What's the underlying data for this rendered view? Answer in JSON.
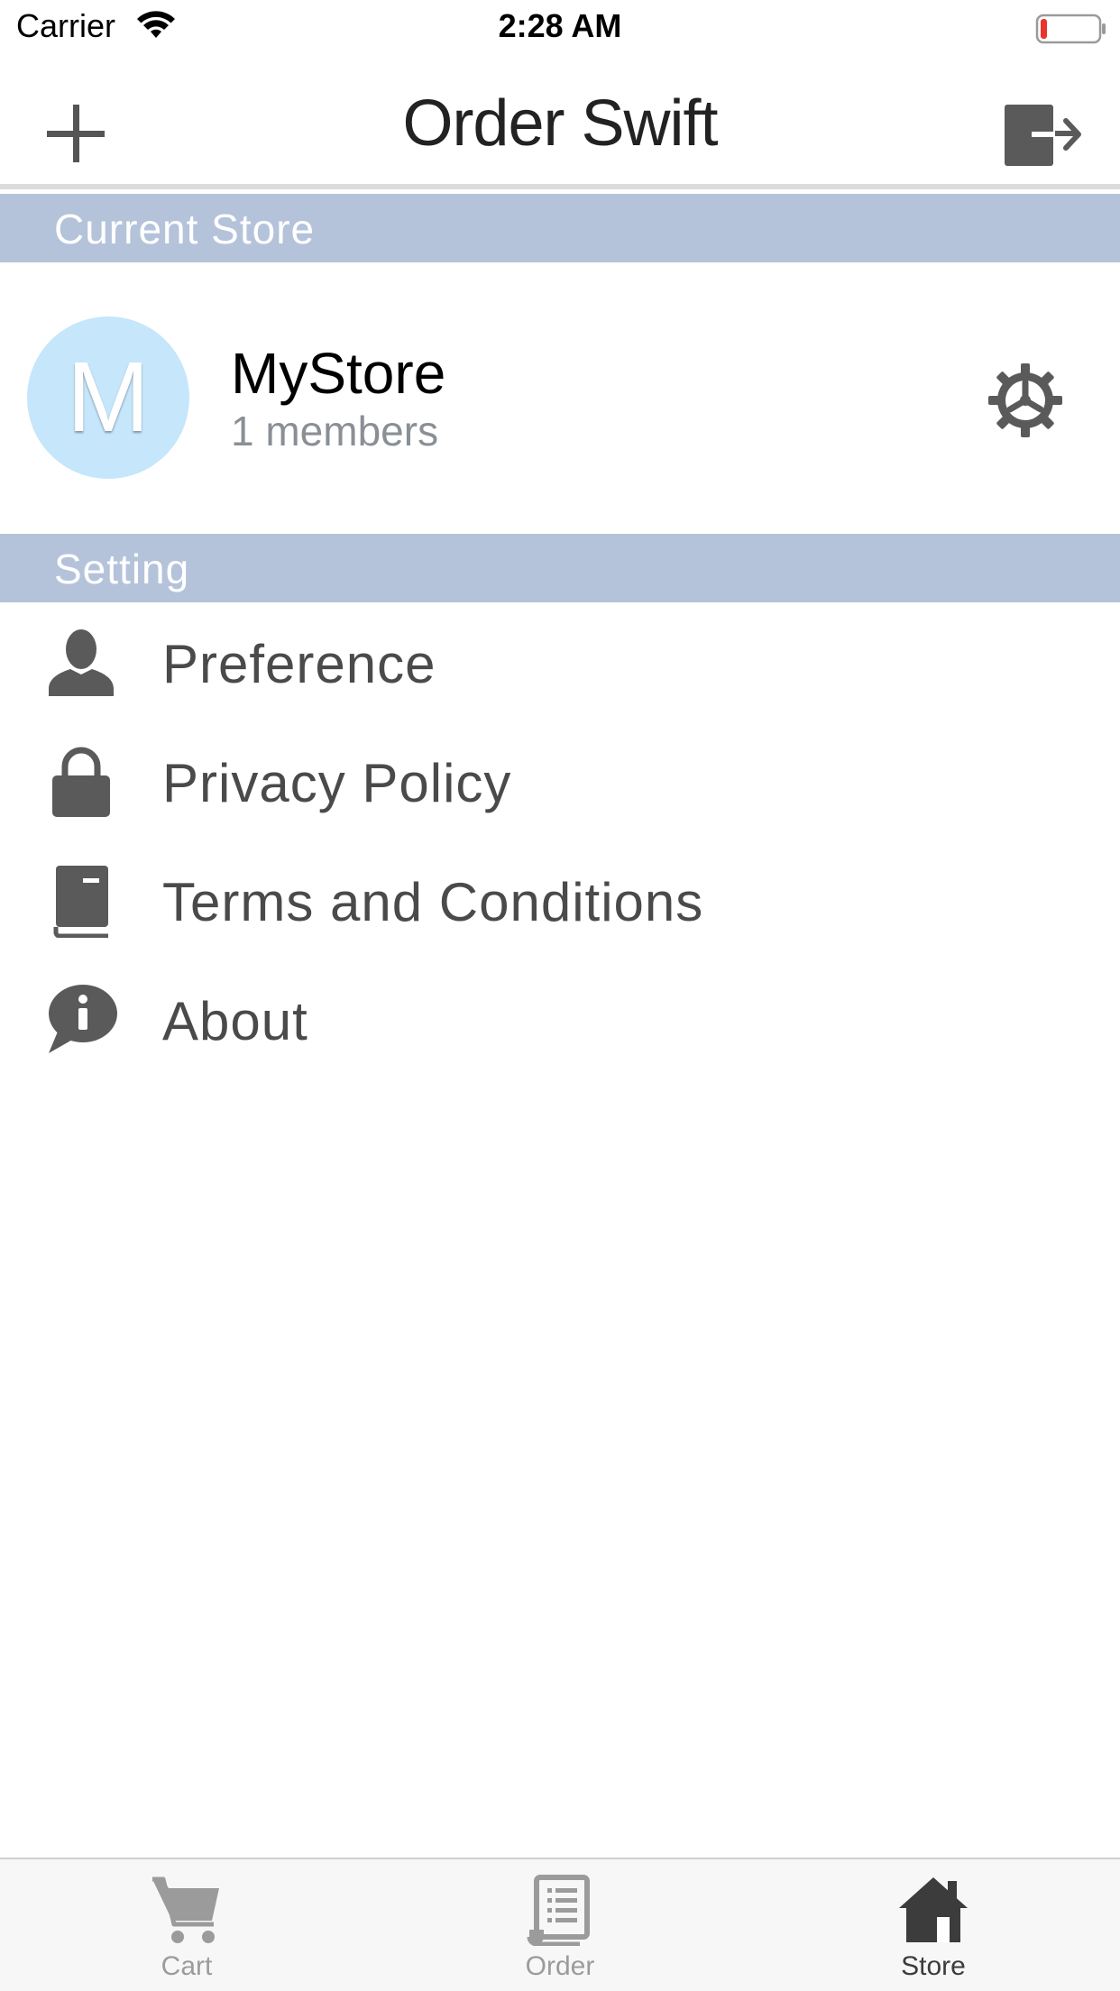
{
  "status_bar": {
    "carrier": "Carrier",
    "time": "2:28 AM",
    "battery_level_fraction": 0.12
  },
  "nav": {
    "title": "Order Swift",
    "left_icon": "plus-icon",
    "right_icon": "logout-icon"
  },
  "sections": {
    "current_store": "Current Store",
    "setting": "Setting"
  },
  "store": {
    "avatar_letter": "M",
    "name": "MyStore",
    "members": "1 members",
    "settings_icon": "gear-icon",
    "avatar_color": "#c5e6fb"
  },
  "settings_items": [
    {
      "label": "Preference",
      "icon": "person-icon"
    },
    {
      "label": "Privacy Policy",
      "icon": "lock-icon"
    },
    {
      "label": "Terms and Conditions",
      "icon": "book-icon"
    },
    {
      "label": "About",
      "icon": "info-bubble-icon"
    }
  ],
  "tabs": [
    {
      "label": "Cart",
      "icon": "cart-icon",
      "active": false
    },
    {
      "label": "Order",
      "icon": "receipt-icon",
      "active": false
    },
    {
      "label": "Store",
      "icon": "house-icon",
      "active": true
    }
  ],
  "colors": {
    "section_header_bg": "#b4c3da",
    "icon_gray": "#5a5a5a",
    "battery_low": "#e8352e",
    "tab_inactive": "#9b9b9b",
    "tab_active": "#3c3c3c"
  }
}
